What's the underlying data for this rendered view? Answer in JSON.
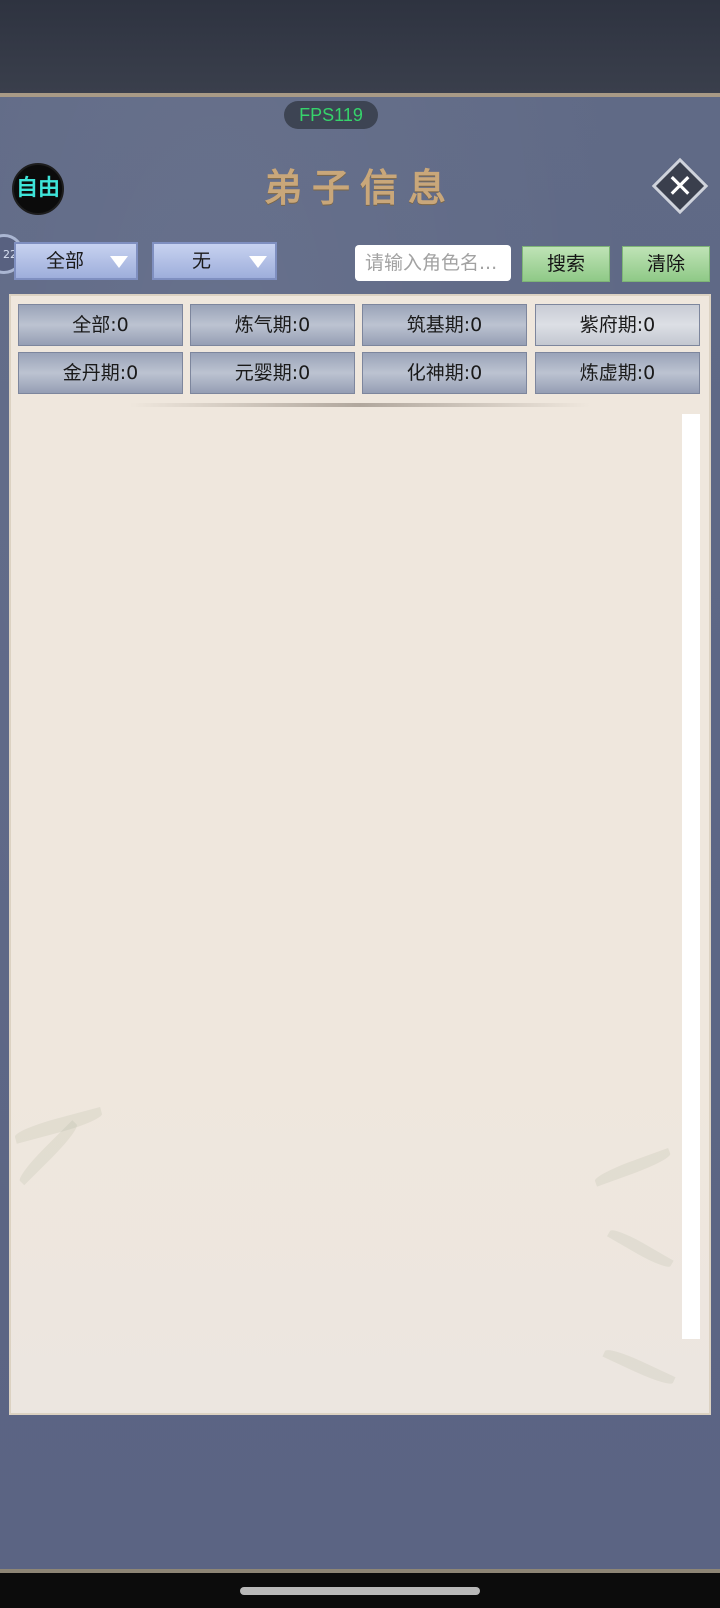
{
  "overlay": {
    "fps": "FPS119"
  },
  "header": {
    "mode_badge": "自由",
    "title": "弟子信息",
    "close_icon": "close-icon",
    "side_ring_text": "22"
  },
  "filters": {
    "realm_dropdown": "全部",
    "second_dropdown": "无",
    "search_placeholder": "请输入角色名...",
    "search_button": "搜索",
    "clear_button": "清除"
  },
  "stages": [
    {
      "label": "全部:0"
    },
    {
      "label": "炼气期:0"
    },
    {
      "label": "筑基期:0"
    },
    {
      "label": "紫府期:0"
    },
    {
      "label": "金丹期:0"
    },
    {
      "label": "元婴期:0"
    },
    {
      "label": "化神期:0"
    },
    {
      "label": "炼虚期:0"
    }
  ],
  "colors": {
    "accent_green": "#8fc987",
    "fps_green": "#36d36b",
    "title_gold": "#c9a77a",
    "mode_cyan": "#3ee4d9"
  }
}
